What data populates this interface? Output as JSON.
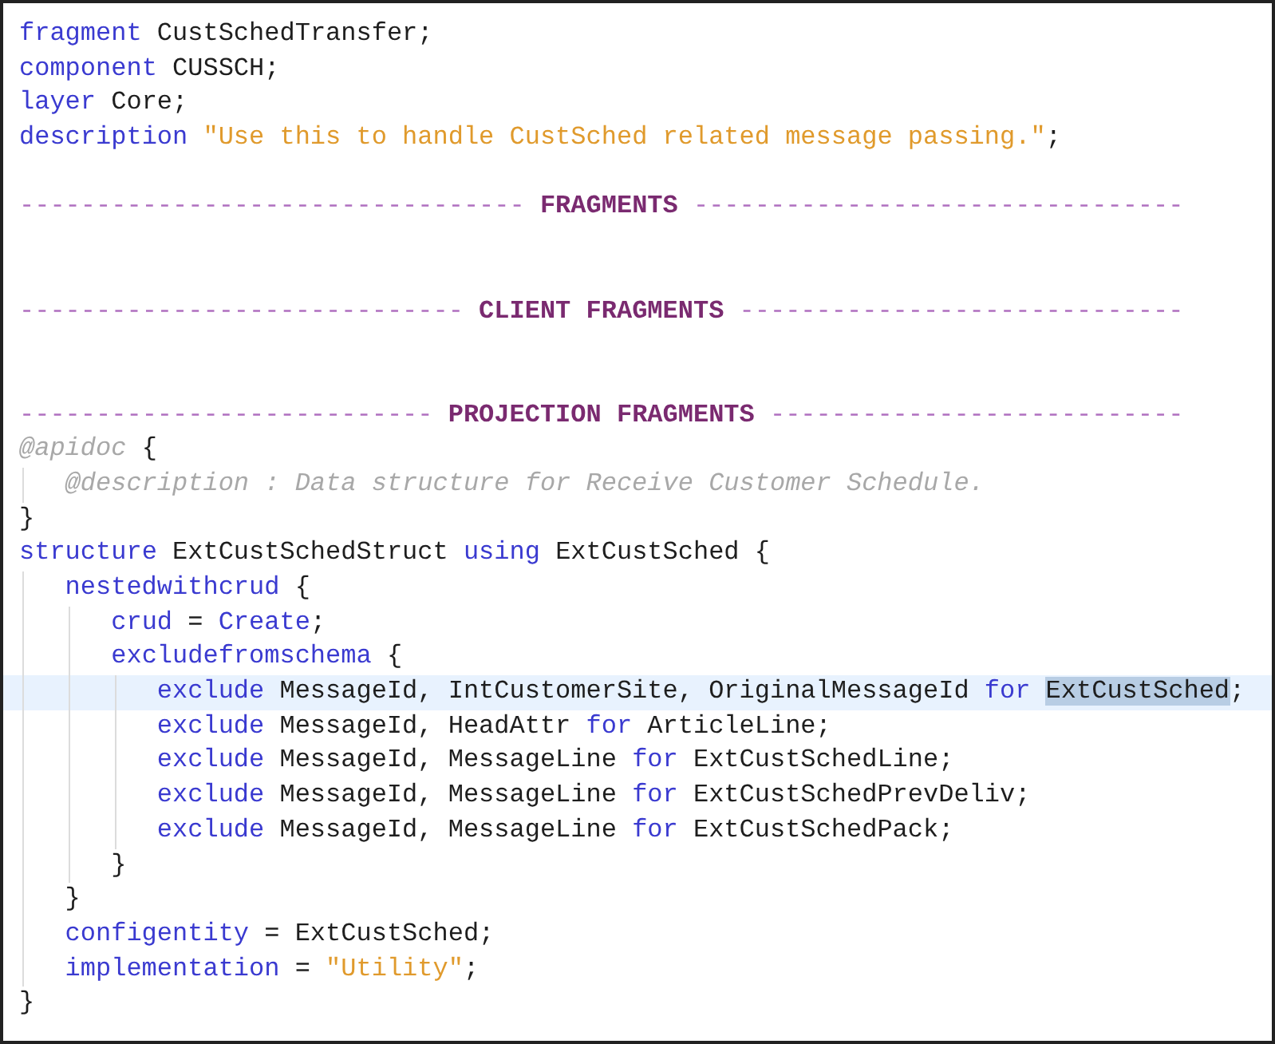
{
  "editor": {
    "lines": [
      {
        "current": false,
        "tokens": [
          {
            "kind": "keyword",
            "text": "fragment ",
            "selected": false
          },
          {
            "kind": "identifier",
            "text": "CustSchedTransfer;",
            "selected": false
          }
        ]
      },
      {
        "current": false,
        "tokens": [
          {
            "kind": "keyword",
            "text": "component ",
            "selected": false
          },
          {
            "kind": "identifier",
            "text": "CUSSCH;",
            "selected": false
          }
        ]
      },
      {
        "current": false,
        "tokens": [
          {
            "kind": "keyword",
            "text": "layer ",
            "selected": false
          },
          {
            "kind": "identifier",
            "text": "Core;",
            "selected": false
          }
        ]
      },
      {
        "current": false,
        "tokens": [
          {
            "kind": "keyword",
            "text": "description ",
            "selected": false
          },
          {
            "kind": "string",
            "text": "\"Use this to handle CustSched related message passing.\"",
            "selected": false
          },
          {
            "kind": "identifier",
            "text": ";",
            "selected": false
          }
        ]
      },
      {
        "current": false
      },
      {
        "current": false,
        "tokens": [
          {
            "kind": "comment",
            "text": "--------------------------------- ",
            "selected": false
          },
          {
            "kind": "section",
            "text": "FRAGMENTS",
            "selected": false
          },
          {
            "kind": "comment",
            "text": " --------------------------------",
            "selected": false
          }
        ]
      },
      {
        "current": false
      },
      {
        "current": false
      },
      {
        "current": false,
        "tokens": [
          {
            "kind": "comment",
            "text": "----------------------------- ",
            "selected": false
          },
          {
            "kind": "section",
            "text": "CLIENT FRAGMENTS",
            "selected": false
          },
          {
            "kind": "comment",
            "text": " -----------------------------",
            "selected": false
          }
        ]
      },
      {
        "current": false
      },
      {
        "current": false
      },
      {
        "current": false,
        "tokens": [
          {
            "kind": "comment",
            "text": "--------------------------- ",
            "selected": false
          },
          {
            "kind": "section",
            "text": "PROJECTION FRAGMENTS",
            "selected": false
          },
          {
            "kind": "comment",
            "text": " ---------------------------",
            "selected": false
          }
        ]
      },
      {
        "current": false,
        "tokens": [
          {
            "kind": "doc",
            "text": "@apidoc ",
            "selected": false
          },
          {
            "kind": "identifier",
            "text": "{",
            "selected": false
          }
        ],
        "children": [
          {
            "current": false,
            "tokens": [
              {
                "kind": "doc",
                "text": "@description : Data structure for Receive Customer Schedule.",
                "selected": false
              }
            ]
          }
        ]
      },
      {
        "current": false,
        "tokens": [
          {
            "kind": "identifier",
            "text": "}",
            "selected": false
          }
        ]
      },
      {
        "current": false,
        "tokens": [
          {
            "kind": "keyword",
            "text": "structure ",
            "selected": false
          },
          {
            "kind": "identifier",
            "text": "ExtCustSchedStruct ",
            "selected": false
          },
          {
            "kind": "keyword",
            "text": "using ",
            "selected": false
          },
          {
            "kind": "identifier",
            "text": "ExtCustSched {",
            "selected": false
          }
        ],
        "children": [
          {
            "current": false,
            "tokens": [
              {
                "kind": "keyword",
                "text": "nestedwithcrud ",
                "selected": false
              },
              {
                "kind": "identifier",
                "text": "{",
                "selected": false
              }
            ],
            "children": [
              {
                "current": false,
                "tokens": [
                  {
                    "kind": "keyword",
                    "text": "crud ",
                    "selected": false
                  },
                  {
                    "kind": "identifier",
                    "text": "= ",
                    "selected": false
                  },
                  {
                    "kind": "keyword",
                    "text": "Create",
                    "selected": false
                  },
                  {
                    "kind": "identifier",
                    "text": ";",
                    "selected": false
                  }
                ]
              },
              {
                "current": false,
                "tokens": [
                  {
                    "kind": "keyword",
                    "text": "excludefromschema ",
                    "selected": false
                  },
                  {
                    "kind": "identifier",
                    "text": "{",
                    "selected": false
                  }
                ],
                "children": [
                  {
                    "current": true,
                    "tokens": [
                      {
                        "kind": "keyword",
                        "text": "exclude ",
                        "selected": false
                      },
                      {
                        "kind": "identifier",
                        "text": "MessageId, IntCustomerSite, OriginalMessageId ",
                        "selected": false
                      },
                      {
                        "kind": "keyword",
                        "text": "for ",
                        "selected": false
                      },
                      {
                        "kind": "identifier",
                        "text": "ExtCustSched",
                        "selected": true
                      },
                      {
                        "kind": "identifier",
                        "text": ";",
                        "selected": false
                      }
                    ]
                  },
                  {
                    "current": false,
                    "tokens": [
                      {
                        "kind": "keyword",
                        "text": "exclude ",
                        "selected": false
                      },
                      {
                        "kind": "identifier",
                        "text": "MessageId, HeadAttr ",
                        "selected": false
                      },
                      {
                        "kind": "keyword",
                        "text": "for ",
                        "selected": false
                      },
                      {
                        "kind": "identifier",
                        "text": "ArticleLine;",
                        "selected": false
                      }
                    ]
                  },
                  {
                    "current": false,
                    "tokens": [
                      {
                        "kind": "keyword",
                        "text": "exclude ",
                        "selected": false
                      },
                      {
                        "kind": "identifier",
                        "text": "MessageId, MessageLine ",
                        "selected": false
                      },
                      {
                        "kind": "keyword",
                        "text": "for ",
                        "selected": false
                      },
                      {
                        "kind": "identifier",
                        "text": "ExtCustSchedLine;",
                        "selected": false
                      }
                    ]
                  },
                  {
                    "current": false,
                    "tokens": [
                      {
                        "kind": "keyword",
                        "text": "exclude ",
                        "selected": false
                      },
                      {
                        "kind": "identifier",
                        "text": "MessageId, MessageLine ",
                        "selected": false
                      },
                      {
                        "kind": "keyword",
                        "text": "for ",
                        "selected": false
                      },
                      {
                        "kind": "identifier",
                        "text": "ExtCustSchedPrevDeliv;",
                        "selected": false
                      }
                    ]
                  },
                  {
                    "current": false,
                    "tokens": [
                      {
                        "kind": "keyword",
                        "text": "exclude ",
                        "selected": false
                      },
                      {
                        "kind": "identifier",
                        "text": "MessageId, MessageLine ",
                        "selected": false
                      },
                      {
                        "kind": "keyword",
                        "text": "for ",
                        "selected": false
                      },
                      {
                        "kind": "identifier",
                        "text": "ExtCustSchedPack;",
                        "selected": false
                      }
                    ]
                  }
                ]
              },
              {
                "current": false,
                "tokens": [
                  {
                    "kind": "identifier",
                    "text": "}",
                    "selected": false
                  }
                ]
              }
            ]
          },
          {
            "current": false,
            "tokens": [
              {
                "kind": "identifier",
                "text": "}",
                "selected": false
              }
            ]
          },
          {
            "current": false,
            "tokens": [
              {
                "kind": "keyword",
                "text": "configentity ",
                "selected": false
              },
              {
                "kind": "identifier",
                "text": "= ExtCustSched;",
                "selected": false
              }
            ]
          },
          {
            "current": false,
            "tokens": [
              {
                "kind": "keyword",
                "text": "implementation ",
                "selected": false
              },
              {
                "kind": "identifier",
                "text": "= ",
                "selected": false
              },
              {
                "kind": "string",
                "text": "\"Utility\"",
                "selected": false
              },
              {
                "kind": "identifier",
                "text": ";",
                "selected": false
              }
            ]
          }
        ]
      },
      {
        "current": false,
        "tokens": [
          {
            "kind": "identifier",
            "text": "}",
            "selected": false
          }
        ]
      }
    ]
  }
}
